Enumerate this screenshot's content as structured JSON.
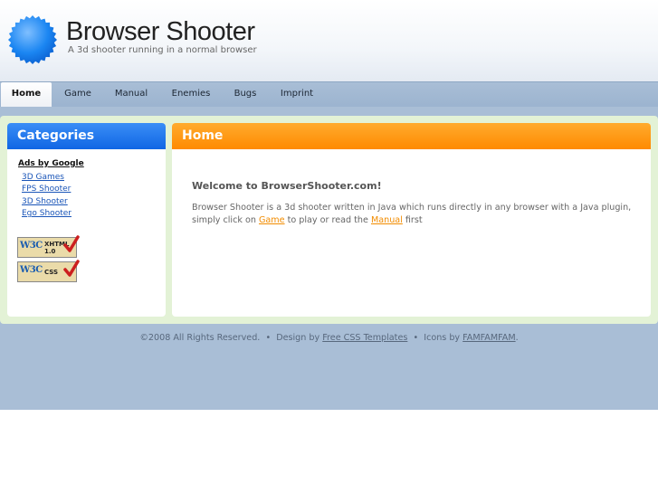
{
  "header": {
    "title": "Browser Shooter",
    "tagline": "A 3d shooter running in a normal browser"
  },
  "nav": {
    "items": [
      {
        "label": "Home",
        "active": true
      },
      {
        "label": "Game"
      },
      {
        "label": "Manual"
      },
      {
        "label": "Enemies"
      },
      {
        "label": "Bugs"
      },
      {
        "label": "Imprint"
      }
    ]
  },
  "sidebar": {
    "title": "Categories",
    "ads_label": "Ads by Google",
    "links": [
      "3D Games",
      "FPS Shooter",
      "3D Shooter",
      "Ego Shooter"
    ],
    "badges": [
      {
        "logo": "W3C",
        "text": "XHTML\n1.0"
      },
      {
        "logo": "W3C",
        "text": "CSS"
      }
    ]
  },
  "main": {
    "title": "Home",
    "welcome": "Welcome to BrowserShooter.com!",
    "text_before": "Browser Shooter is a 3d shooter written in Java which runs directly in any browser with a Java plugin, simply click on ",
    "link_game": "Game",
    "text_middle": " to play or read the ",
    "link_manual": "Manual",
    "text_after": " first"
  },
  "footer": {
    "copyright": "©2008 All Rights Reserved.",
    "sep1": "•",
    "design_by": "Design by",
    "design_link": "Free CSS Templates",
    "sep2": "•",
    "icons_by": "Icons by",
    "icons_link": "FAMFAMFAM",
    "end": "."
  },
  "colors": {
    "accent_blue": "#1a6fe8",
    "accent_orange": "#ff8a00",
    "nav_band": "#a9bed6",
    "frame_green": "#e3f2d6"
  }
}
